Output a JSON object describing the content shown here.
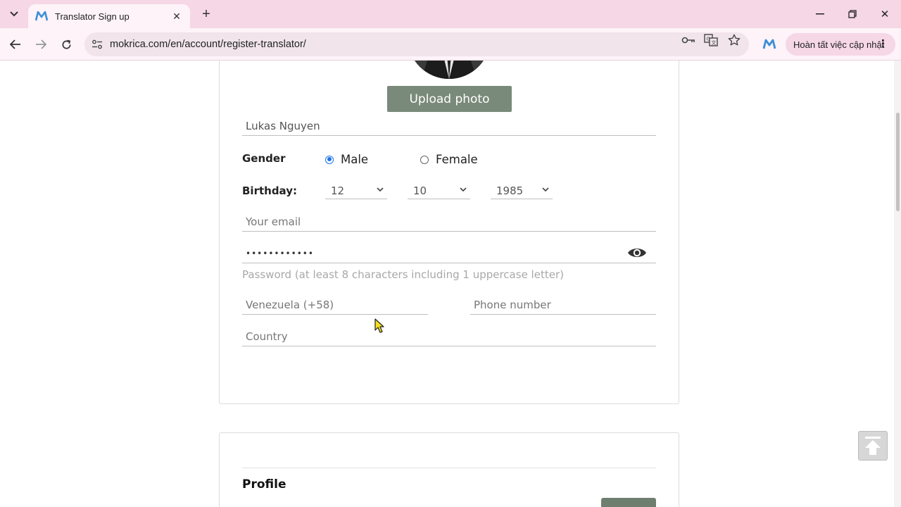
{
  "browser": {
    "tab_title": "Translator Sign up",
    "url": "mokrica.com/en/account/register-translator/",
    "update_label": "Hoàn tất việc cập nhật",
    "accent_color": "#f6d7e6"
  },
  "form": {
    "upload_label": "Upload photo",
    "name_value": "Lukas Nguyen",
    "gender_label": "Gender",
    "gender_options": [
      "Male",
      "Female"
    ],
    "gender_selected": "Male",
    "birthday_label": "Birthday:",
    "birthday_day": "12",
    "birthday_month": "10",
    "birthday_year": "1985",
    "email_placeholder": "Your email",
    "password_value": "••••••••••••",
    "password_hint": "Password (at least 8 characters including 1 uppercase letter)",
    "phone_code_placeholder": "Venezuela (+58)",
    "phone_placeholder": "Phone number",
    "country_placeholder": "Country",
    "button_color": "#7a8a7a"
  },
  "profile_section": {
    "title": "Profile"
  }
}
